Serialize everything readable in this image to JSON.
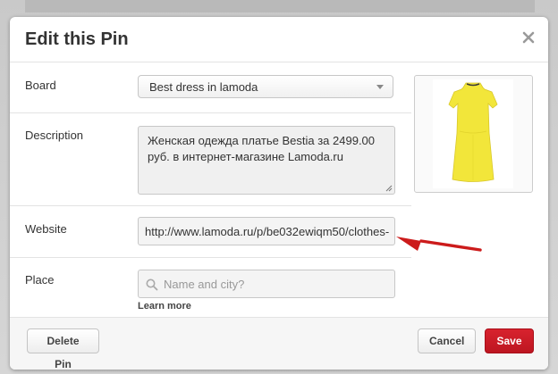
{
  "colors": {
    "save_button_bg": "#c8191f",
    "arrow": "#cc1b1b",
    "dress": "#f2e63a"
  },
  "modal": {
    "title": "Edit this Pin",
    "close_icon": "close-icon"
  },
  "form": {
    "board": {
      "label": "Board",
      "selected": "Best dress in lamoda"
    },
    "description": {
      "label": "Description",
      "value": "Женская одежда платье Bestia за 2499.00 руб. в интернет-магазине Lamoda.ru"
    },
    "website": {
      "label": "Website",
      "value": "http://www.lamoda.ru/p/be032ewiqm50/clothes-"
    },
    "place": {
      "label": "Place",
      "placeholder": "Name and city?",
      "learn_more": "Learn more"
    }
  },
  "preview": {
    "icon": "dress-image"
  },
  "footer": {
    "delete_label": "Delete Pin",
    "cancel_label": "Cancel",
    "save_label": "Save"
  }
}
